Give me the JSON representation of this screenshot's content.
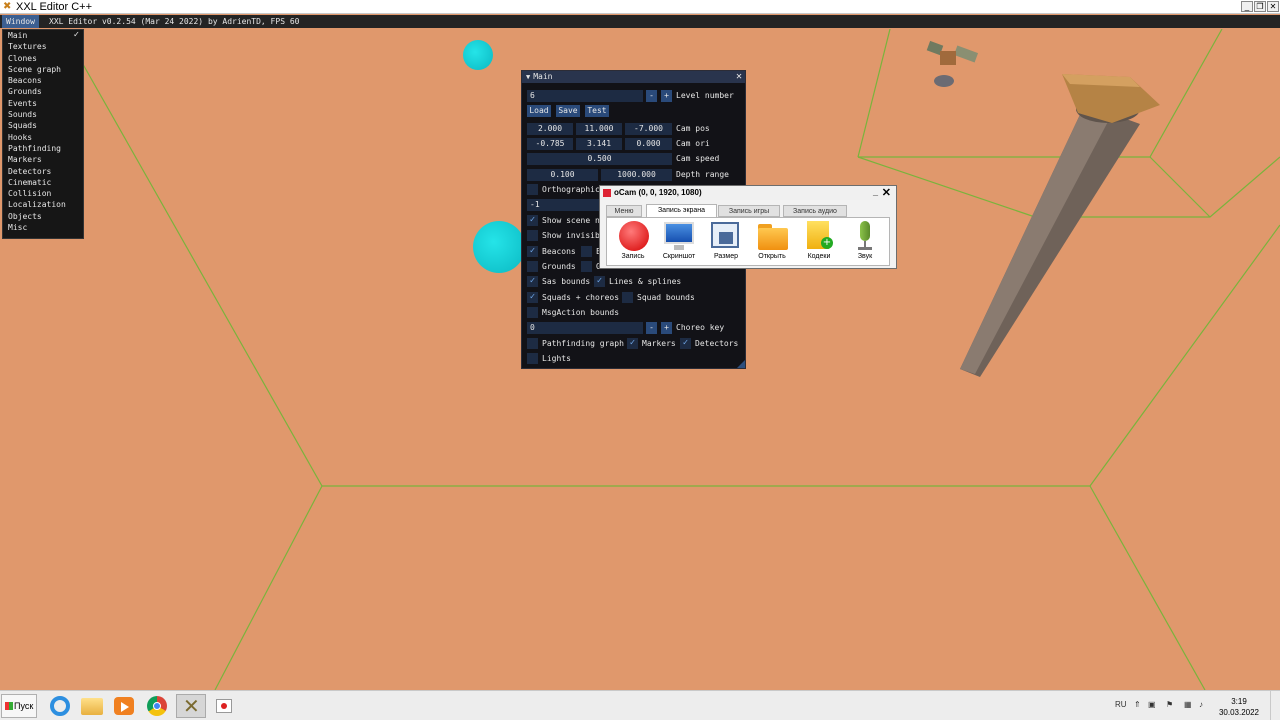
{
  "window": {
    "title": "XXL Editor C++",
    "controls": [
      "_",
      "❐",
      "✕"
    ]
  },
  "menubar": {
    "window_menu": "Window",
    "app_title": "XXL Editor v0.2.54 (Mar 24 2022) by AdrienTD, FPS 60"
  },
  "window_menu": {
    "check_glyph": "✓",
    "items": [
      "Main",
      "Textures",
      "Clones",
      "Scene graph",
      "Beacons",
      "Grounds",
      "Events",
      "Sounds",
      "Squads",
      "Hooks",
      "Pathfinding",
      "Markers",
      "Detectors",
      "Cinematic",
      "Collision",
      "Localization",
      "Objects",
      "Misc"
    ]
  },
  "main_window": {
    "title": "Main",
    "close": "✕",
    "level_value": "6",
    "minus": "-",
    "plus": "+",
    "level_label": "Level number",
    "load_label": "Load",
    "save_label": "Save",
    "test_label": "Test",
    "cam_pos": [
      "2.000",
      "11.000",
      "-7.000"
    ],
    "cam_pos_label": "Cam pos",
    "cam_ori": [
      "-0.785",
      "3.141",
      "0.000"
    ],
    "cam_ori_label": "Cam ori",
    "cam_speed": "0.500",
    "cam_speed_label": "Cam speed",
    "depth_range": [
      "0.100",
      "1000.000"
    ],
    "depth_range_label": "Depth range",
    "orthographic_label": "Orthographic",
    "selected_value": "-1",
    "show_scene_label": "Show scene n",
    "show_invisible_label": "Show invisib",
    "beacons_label": "Beacons",
    "beacons_extra_label": "E",
    "grounds_label": "Grounds",
    "grounds_extra_label": "G",
    "sas_bounds_label": "Sas bounds",
    "lines_splines_label": "Lines & splines",
    "squads_choreos_label": "Squads + choreos",
    "squad_bounds_label": "Squad bounds",
    "msgaction_label": "MsgAction bounds",
    "choreo_value": "0",
    "choreo_label": "Choreo key",
    "pathfinding_label": "Pathfinding graph",
    "markers_label": "Markers",
    "detectors_label": "Detectors",
    "lights_label": "Lights",
    "check_glyph": "✓",
    "checks": {
      "orthographic": false,
      "show_scene": true,
      "show_invisible": false,
      "beacons": true,
      "beacons_extra": false,
      "grounds": false,
      "grounds_extra": false,
      "sas_bounds": true,
      "lines_splines": true,
      "squads_choreos": true,
      "squad_bounds": false,
      "msgaction": false,
      "pathfinding": false,
      "markers": true,
      "detectors": true,
      "lights": false
    }
  },
  "ocam": {
    "title": "oCam (0, 0, 1920, 1080)",
    "minimize": "_",
    "close": "✕",
    "tabs": [
      "Меню",
      "Запись экрана",
      "Запись игры",
      "Запись аудио"
    ],
    "active_tab": 1,
    "tools": [
      "Запись",
      "Скриншот",
      "Размер",
      "Открыть",
      "Кодеки",
      "Звук"
    ]
  },
  "taskbar": {
    "start_label": "Пуск",
    "lang": "RU",
    "time": "3:19",
    "date": "30.03.2022"
  },
  "colors": {
    "ground": "#e0986c",
    "grid_line": "#7ab33c",
    "orb": "#14d0d8",
    "imgui_bg": "#121217",
    "imgui_accent": "#3c5f91"
  }
}
